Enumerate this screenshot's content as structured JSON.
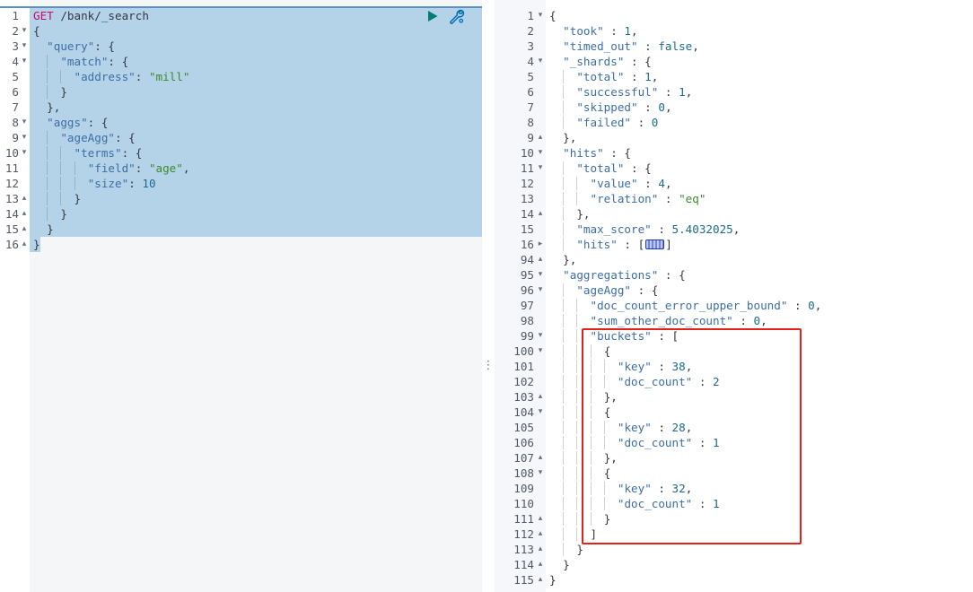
{
  "colors": {
    "method": "#c80a68",
    "key": "#3c6ea6",
    "string": "#3b8a2e",
    "number": "#1a6b8a",
    "selection": "#b5d3e8",
    "annotation": "#e3211b",
    "send": "#017d73",
    "settings": "#006bb4"
  },
  "toolbar": {
    "send_icon": "play-icon",
    "settings_icon": "wrench-icon"
  },
  "resizer_icon": "vertical-dots-icon",
  "request_editor": {
    "lines": [
      {
        "n": "1",
        "text": "GET /bank/_search"
      },
      {
        "n": "2",
        "fold": "fold-open",
        "text": "{"
      },
      {
        "n": "3",
        "fold": "fold-open",
        "text": "  \"query\": {"
      },
      {
        "n": "4",
        "fold": "fold-open",
        "text": "    \"match\": {"
      },
      {
        "n": "5",
        "text": "      \"address\": \"mill\""
      },
      {
        "n": "6",
        "text": "    }"
      },
      {
        "n": "7",
        "text": "  },"
      },
      {
        "n": "8",
        "fold": "fold-open",
        "text": "  \"aggs\": {"
      },
      {
        "n": "9",
        "fold": "fold-open",
        "text": "    \"ageAgg\": {"
      },
      {
        "n": "10",
        "fold": "fold-open",
        "text": "      \"terms\": {"
      },
      {
        "n": "11",
        "text": "        \"field\": \"age\","
      },
      {
        "n": "12",
        "text": "        \"size\": 10"
      },
      {
        "n": "13",
        "fold": "fold-end",
        "text": "      }"
      },
      {
        "n": "14",
        "fold": "fold-end",
        "text": "    }"
      },
      {
        "n": "15",
        "fold": "fold-end",
        "text": "  }"
      },
      {
        "n": "16",
        "fold": "fold-end",
        "text": "}"
      }
    ]
  },
  "response_editor": {
    "lines": [
      {
        "n": "1",
        "fold": "fold-open",
        "text": "{"
      },
      {
        "n": "2",
        "text": "  \"took\" : 1,"
      },
      {
        "n": "3",
        "text": "  \"timed_out\" : false,"
      },
      {
        "n": "4",
        "fold": "fold-open",
        "text": "  \"_shards\" : {"
      },
      {
        "n": "5",
        "text": "    \"total\" : 1,"
      },
      {
        "n": "6",
        "text": "    \"successful\" : 1,"
      },
      {
        "n": "7",
        "text": "    \"skipped\" : 0,"
      },
      {
        "n": "8",
        "text": "    \"failed\" : 0"
      },
      {
        "n": "9",
        "fold": "fold-end",
        "text": "  },"
      },
      {
        "n": "10",
        "fold": "fold-open",
        "text": "  \"hits\" : {"
      },
      {
        "n": "11",
        "fold": "fold-open",
        "text": "    \"total\" : {"
      },
      {
        "n": "12",
        "text": "      \"value\" : 4,"
      },
      {
        "n": "13",
        "text": "      \"relation\" : \"eq\""
      },
      {
        "n": "14",
        "fold": "fold-end",
        "text": "    },"
      },
      {
        "n": "15",
        "text": "    \"max_score\" : 5.4032025,"
      },
      {
        "n": "16",
        "fold": "fold-collapsed",
        "text": "    \"hits\" : [",
        "text_after": "]"
      },
      {
        "n": "94",
        "fold": "fold-end",
        "text": "  },"
      },
      {
        "n": "95",
        "fold": "fold-open",
        "text": "  \"aggregations\" : {"
      },
      {
        "n": "96",
        "fold": "fold-open",
        "text": "    \"ageAgg\" : {"
      },
      {
        "n": "97",
        "text": "      \"doc_count_error_upper_bound\" : 0,"
      },
      {
        "n": "98",
        "text": "      \"sum_other_doc_count\" : 0,"
      },
      {
        "n": "99",
        "fold": "fold-open",
        "text": "      \"buckets\" : ["
      },
      {
        "n": "100",
        "fold": "fold-open",
        "text": "        {"
      },
      {
        "n": "101",
        "text": "          \"key\" : 38,"
      },
      {
        "n": "102",
        "text": "          \"doc_count\" : 2"
      },
      {
        "n": "103",
        "fold": "fold-end",
        "text": "        },"
      },
      {
        "n": "104",
        "fold": "fold-open",
        "text": "        {"
      },
      {
        "n": "105",
        "text": "          \"key\" : 28,"
      },
      {
        "n": "106",
        "text": "          \"doc_count\" : 1"
      },
      {
        "n": "107",
        "fold": "fold-end",
        "text": "        },"
      },
      {
        "n": "108",
        "fold": "fold-open",
        "text": "        {"
      },
      {
        "n": "109",
        "text": "          \"key\" : 32,"
      },
      {
        "n": "110",
        "text": "          \"doc_count\" : 1"
      },
      {
        "n": "111",
        "fold": "fold-end",
        "text": "        }"
      },
      {
        "n": "112",
        "fold": "fold-end",
        "text": "      ]"
      },
      {
        "n": "113",
        "fold": "fold-end",
        "text": "    }"
      },
      {
        "n": "114",
        "fold": "fold-end",
        "text": "  }"
      },
      {
        "n": "115",
        "fold": "fold-end",
        "text": "}"
      }
    ]
  }
}
